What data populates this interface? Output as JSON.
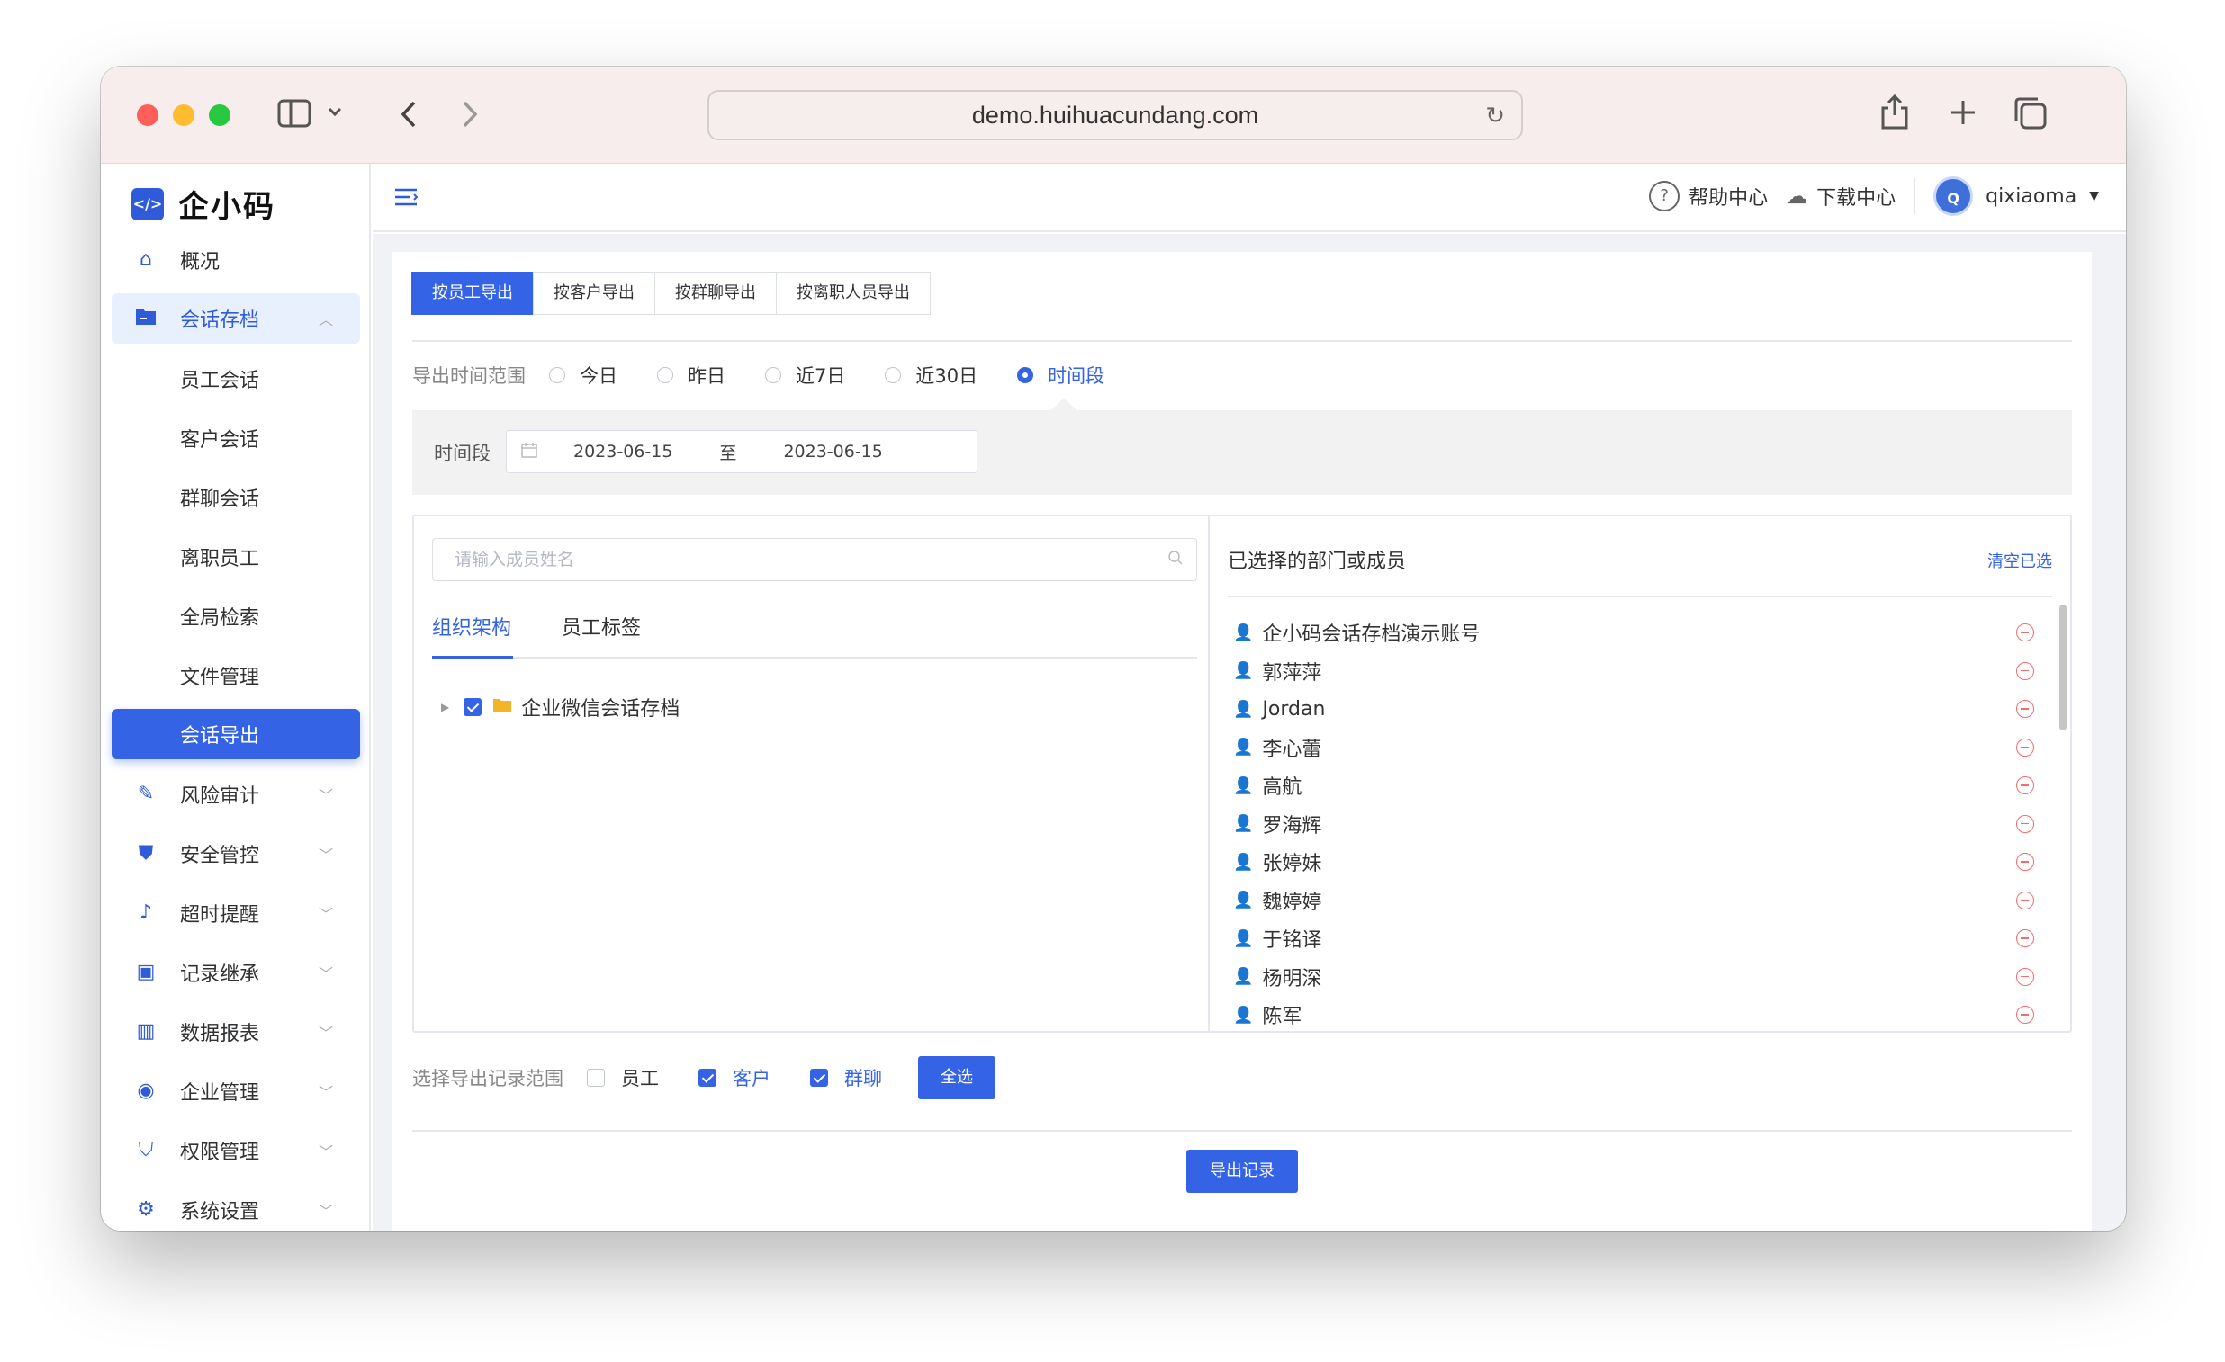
{
  "browser": {
    "url": "demo.huihuacundang.com"
  },
  "app": {
    "logo_text": "企小码",
    "logo_mark": "</>"
  },
  "sidebar": {
    "items": [
      {
        "label": "概况",
        "icon": "home-icon"
      },
      {
        "label": "会话存档",
        "icon": "folder-icon",
        "expanded": true
      },
      {
        "label": "风险审计",
        "icon": "audit-icon"
      },
      {
        "label": "安全管控",
        "icon": "shield-icon"
      },
      {
        "label": "超时提醒",
        "icon": "bell-icon"
      },
      {
        "label": "记录继承",
        "icon": "inherit-icon"
      },
      {
        "label": "数据报表",
        "icon": "chart-icon"
      },
      {
        "label": "企业管理",
        "icon": "enterprise-icon"
      },
      {
        "label": "权限管理",
        "icon": "permission-icon"
      },
      {
        "label": "系统设置",
        "icon": "gear-icon"
      }
    ],
    "subitems": [
      "员工会话",
      "客户会话",
      "群聊会话",
      "离职员工",
      "全局检索",
      "文件管理",
      "会话导出"
    ],
    "active_sub": "会话导出"
  },
  "topbar": {
    "help": "帮助中心",
    "download": "下载中心",
    "avatar_letter": "Q",
    "username": "qixiaoma"
  },
  "export": {
    "tabs": [
      "按员工导出",
      "按客户导出",
      "按群聊导出",
      "按离职人员导出"
    ],
    "active_tab": "按员工导出",
    "range_label": "导出时间范围",
    "range_options": [
      "今日",
      "昨日",
      "近7日",
      "近30日",
      "时间段"
    ],
    "range_selected": "时间段",
    "period_label": "时间段",
    "date_start": "2023-06-15",
    "date_sep": "至",
    "date_end": "2023-06-15",
    "search_placeholder": "请输入成员姓名",
    "panel_tabs": [
      "组织架构",
      "员工标签"
    ],
    "tree_root": "企业微信会话存档",
    "selected_title": "已选择的部门或成员",
    "clear_label": "清空已选",
    "selected_members": [
      "企小码会话存档演示账号",
      "郭萍萍",
      "Jordan",
      "李心蕾",
      "高航",
      "罗海辉",
      "张婷妹",
      "魏婷婷",
      "于铭译",
      "杨明深",
      "陈军"
    ],
    "scope_label": "选择导出记录范围",
    "scope_options": [
      {
        "label": "员工",
        "checked": false
      },
      {
        "label": "客户",
        "checked": true
      },
      {
        "label": "群聊",
        "checked": true
      }
    ],
    "select_all": "全选",
    "export_button": "导出记录"
  },
  "colors": {
    "primary": "#3463e6",
    "danger": "#f56c6c",
    "folder": "#f4b427"
  }
}
